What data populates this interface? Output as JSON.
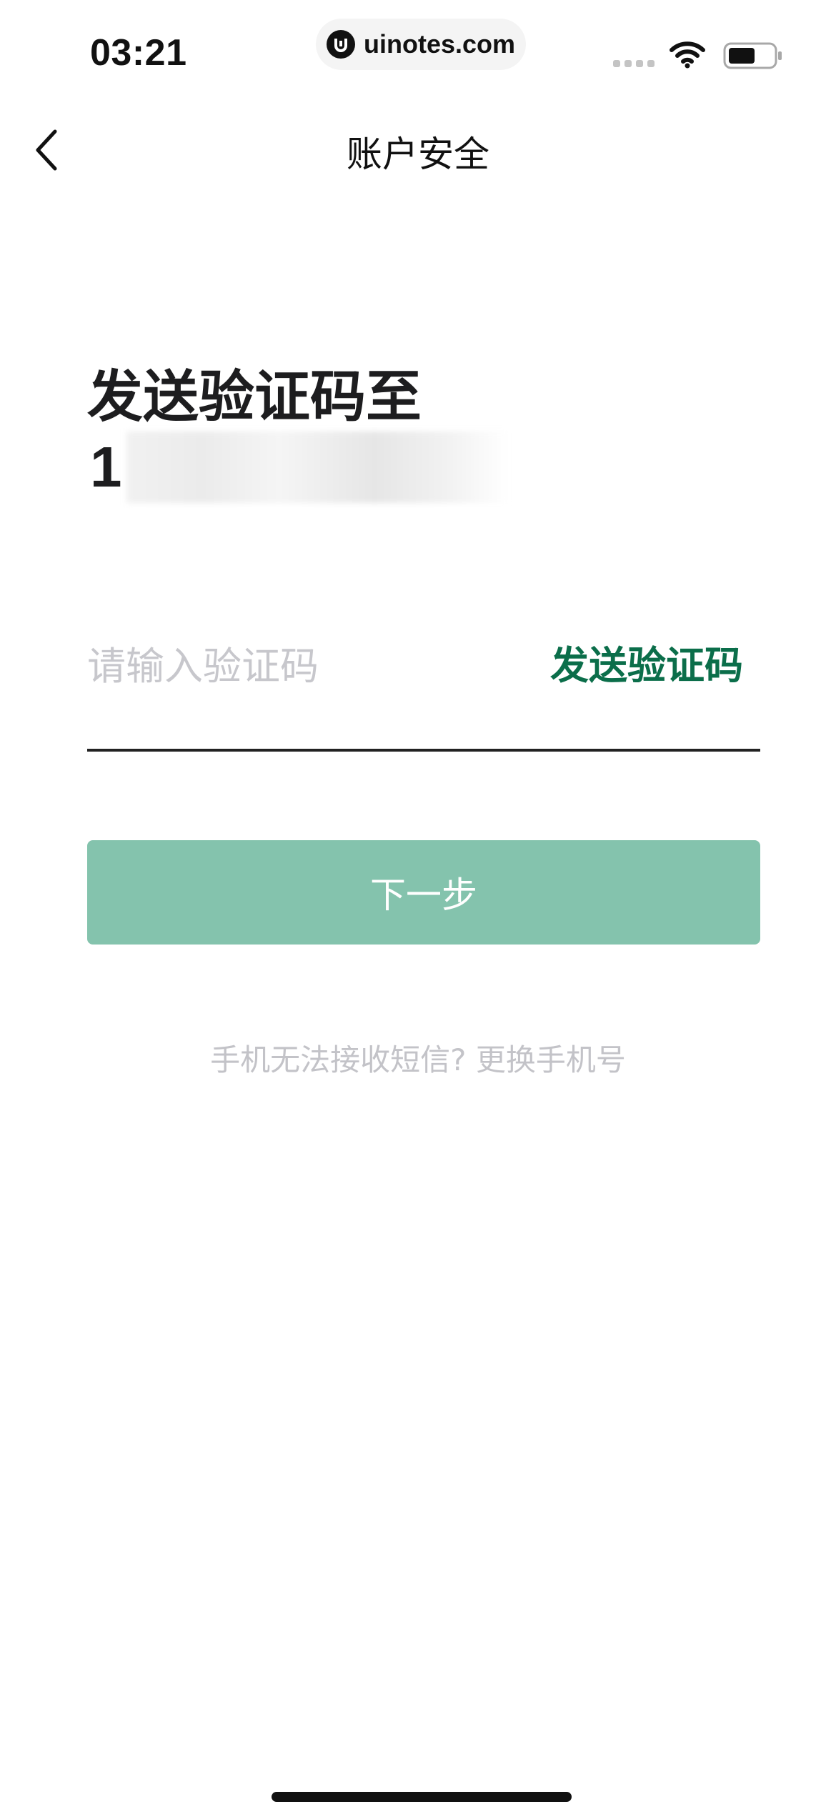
{
  "status_bar": {
    "time": "03:21",
    "url": "uinotes.com"
  },
  "nav": {
    "title": "账户安全"
  },
  "verify": {
    "heading": "发送验证码至",
    "phone_prefix": "1",
    "code_placeholder": "请输入验证码",
    "send_code_label": "发送验证码",
    "next_label": "下一步",
    "cannot_receive_text": "手机无法接收短信?",
    "change_phone_label": "更换手机号"
  },
  "colors": {
    "accent": "#0b6e4a",
    "button_disabled": "#84c3ad",
    "hint_text": "#c3c3c8"
  },
  "icons": {
    "back": "chevron-left-icon",
    "wifi": "wifi-icon",
    "battery": "battery-icon",
    "site_logo": "uinotes-logo-icon"
  }
}
